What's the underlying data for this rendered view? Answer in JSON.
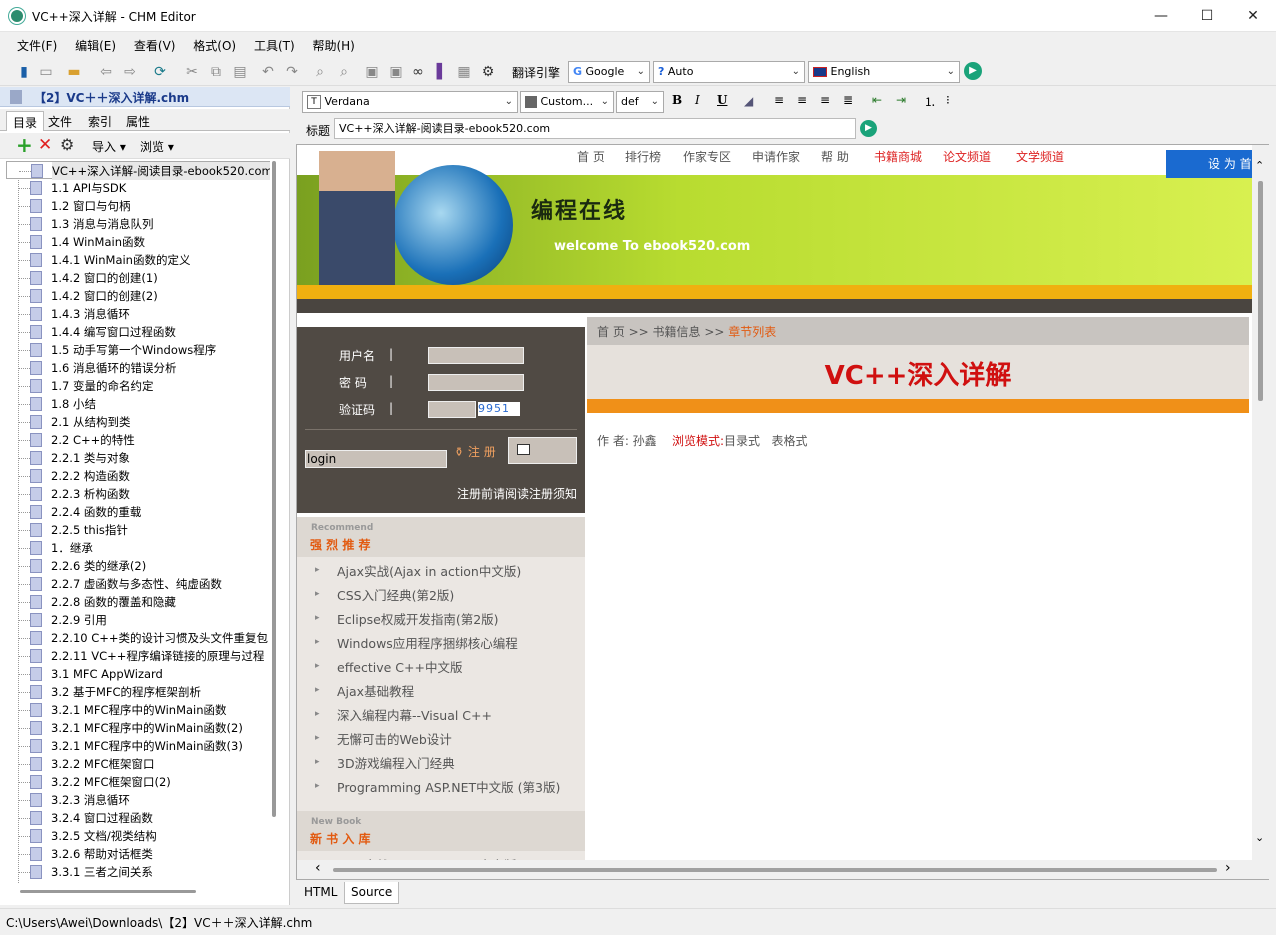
{
  "window": {
    "title": "VC++深入详解 - CHM Editor",
    "minimize": "—",
    "maximize": "☐",
    "close": "✕"
  },
  "menu": [
    "文件(F)",
    "编辑(E)",
    "查看(V)",
    "格式(O)",
    "工具(T)",
    "帮助(H)"
  ],
  "toolbar": {
    "translate_label": "翻译引擎",
    "engine": "Google",
    "source_lang": "Auto",
    "target_lang": "English"
  },
  "left": {
    "file_header": "【2】VC＋＋深入详解.chm",
    "tabs": [
      "目录",
      "文件",
      "索引",
      "属性"
    ],
    "import_label": "导入",
    "browse_label": "浏览",
    "tree": [
      "VC++深入详解-阅读目录-ebook520.com",
      "1.1 API与SDK",
      "1.2 窗口与句柄",
      "1.3 消息与消息队列",
      "1.4 WinMain函数",
      "1.4.1 WinMain函数的定义",
      "1.4.2 窗口的创建(1)",
      "1.4.2 窗口的创建(2)",
      "1.4.3 消息循环",
      "1.4.4 编写窗口过程函数",
      "1.5 动手写第一个Windows程序",
      "1.6 消息循环的错误分析",
      "1.7 变量的命名约定",
      "1.8 小结",
      "2.1 从结构到类",
      "2.2 C++的特性",
      "2.2.1 类与对象",
      "2.2.2 构造函数",
      "2.2.3 析构函数",
      "2.2.4 函数的重载",
      "2.2.5 this指针",
      "1．继承",
      "2.2.6 类的继承(2)",
      "2.2.7 虚函数与多态性、纯虚函数",
      "2.2.8 函数的覆盖和隐藏",
      "2.2.9 引用",
      "2.2.10 C++类的设计习惯及头文件重复包",
      "2.2.11 VC++程序编译链接的原理与过程",
      "3.1 MFC AppWizard",
      "3.2 基于MFC的程序框架剖析",
      "3.2.1 MFC程序中的WinMain函数",
      "3.2.1 MFC程序中的WinMain函数(2)",
      "3.2.1 MFC程序中的WinMain函数(3)",
      "3.2.2 MFC框架窗口",
      "3.2.2 MFC框架窗口(2)",
      "3.2.3 消息循环",
      "3.2.4 窗口过程函数",
      "3.2.5 文档/视类结构",
      "3.2.6 帮助对话框类",
      "3.3.1 三者之间关系"
    ]
  },
  "format": {
    "font": "Verdana",
    "color_label": "Custom...",
    "size": "def",
    "bold": "B",
    "italic": "I",
    "underline": "U"
  },
  "title_row": {
    "label": "标题",
    "value": "VC++深入详解-阅读目录-ebook520.com"
  },
  "page": {
    "nav": [
      "首 页",
      "排行榜",
      "作家专区",
      "申请作家",
      "帮 助"
    ],
    "nav_red": [
      "书籍商城",
      "论文频道",
      "文学频道"
    ],
    "set_home": "设 为 首",
    "banner_title": "编程在线",
    "banner_welcome": "welcome To  ebook520.com",
    "login": {
      "username_label": "用户名",
      "password_label": "密  码",
      "captcha_label": "验证码",
      "captcha_value": "9951",
      "login_value": "login",
      "register": "注 册",
      "notice": "注册前请阅读注册须知"
    },
    "breadcrumb": "首 页 >> 书籍信息 >> ",
    "breadcrumb_current": "章节列表",
    "book_title": "VC++深入详解",
    "author_line": "作 者: 孙鑫",
    "browse_mode_label": "浏览模式:",
    "browse_mode_dir": "目录式",
    "browse_mode_table": "表格式",
    "recommend_en": "Recommend",
    "recommend_cn": "强  烈  推  荐",
    "recommend_items": [
      "Ajax实战(Ajax in action中文版)",
      "CSS入门经典(第2版)",
      "Eclipse权威开发指南(第2版)",
      "Windows应用程序捆绑核心编程",
      "effective C++中文版",
      "Ajax基础教程",
      "深入编程内幕--Visual C++",
      "无懈可击的Web设计",
      "3D游戏编程入门经典",
      "Programming ASP.NET中文版 (第3版)"
    ],
    "newbook_en": "New Book",
    "newbook_cn": "新  书  入  库",
    "newbook_first": "Ajax实战(Ajax in action中文版)"
  },
  "bottom_tabs": [
    "HTML",
    "Source"
  ],
  "status": "C:\\Users\\Awei\\Downloads\\【2】VC＋＋深入详解.chm"
}
